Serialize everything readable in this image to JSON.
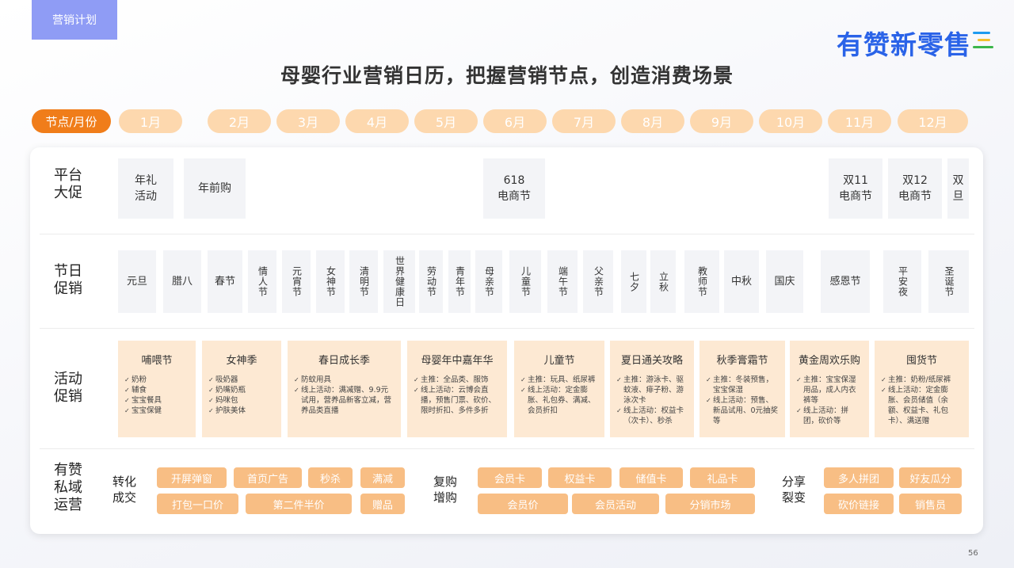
{
  "section_tag": "营销计划",
  "logo_text": "有赞新零售",
  "logo_colors": [
    "#1e9bf0",
    "#f2c12e",
    "#3cb64a"
  ],
  "title": "母婴行业营销日历，把握营销节点，创造消费场景",
  "header_first": "节点/月份",
  "months": [
    "1月",
    "2月",
    "3月",
    "4月",
    "5月",
    "6月",
    "7月",
    "8月",
    "9月",
    "10月",
    "11月",
    "12月"
  ],
  "rows": {
    "platform": {
      "label": "平台\n大促",
      "items": [
        "年礼\n活动",
        "年前购",
        "618\n电商节",
        "双11\n电商节",
        "双12\n电商节",
        "双\n旦"
      ]
    },
    "holiday": {
      "label": "节日\n促销",
      "items": [
        "元旦",
        "腊八",
        "春节",
        "情人节",
        "元宵节",
        "女神节",
        "清明节",
        "世界健康日",
        "劳动节",
        "青年节",
        "母亲节",
        "儿童节",
        "端午节",
        "父亲节",
        "七夕",
        "立秋",
        "教师节",
        "中秋",
        "国庆",
        "感恩节",
        "平安夜",
        "圣诞节"
      ]
    },
    "activity": {
      "label": "活动\n促销",
      "items": [
        {
          "title": "哺喂节",
          "points": [
            "奶粉",
            "辅食",
            "宝宝餐具",
            "宝宝保健"
          ]
        },
        {
          "title": "女神季",
          "points": [
            "吸奶器",
            "奶嘴奶瓶",
            "妈咪包",
            "护肤美体"
          ]
        },
        {
          "title": "春日成长季",
          "points": [
            "防蚊用具",
            "线上活动：满减赠、9.9元试用，营养品新客立减，营养品类直播"
          ]
        },
        {
          "title": "母婴年中嘉年华",
          "points": [
            "主推：全品类、服饰",
            "线上活动：云博会直播，预售门票、砍价、限时折扣、多件多折"
          ]
        },
        {
          "title": "儿童节",
          "points": [
            "主推：玩具、纸尿裤",
            "线上活动：定金膨胀、礼包券、满减、会员折扣"
          ]
        },
        {
          "title": "夏日通关攻略",
          "points": [
            "主推：游泳卡、驱蚊液、痱子粉、游泳次卡",
            "线上活动：权益卡（次卡）、秒杀"
          ]
        },
        {
          "title": "秋季膏霜节",
          "points": [
            "主推：冬装预售，宝宝保湿",
            "线上活动：预售、新品试用、0元抽奖等"
          ]
        },
        {
          "title": "黄金周欢乐购",
          "points": [
            "主推：宝宝保湿用品，成人内衣裤等",
            "线上活动：拼团，砍价等"
          ]
        },
        {
          "title": "囤货节",
          "points": [
            "主推：奶粉/纸尿裤",
            "线上活动：定金膨胀、会员储值（余额、权益卡、礼包卡）、满送赠"
          ]
        }
      ]
    },
    "private": {
      "label": "有赞\n私域\n运营",
      "groups": [
        {
          "label": "转化\n成交",
          "items": [
            "开屏弹窗",
            "首页广告",
            "秒杀",
            "满减",
            "打包一口价",
            "第二件半价",
            "赠品"
          ]
        },
        {
          "label": "复购\n增购",
          "items": [
            "会员卡",
            "权益卡",
            "储值卡",
            "礼品卡",
            "会员价",
            "会员活动",
            "分销市场"
          ]
        },
        {
          "label": "分享\n裂变",
          "items": [
            "多人拼团",
            "好友瓜分",
            "砍价链接",
            "销售员"
          ]
        }
      ]
    }
  },
  "page_number": "56"
}
